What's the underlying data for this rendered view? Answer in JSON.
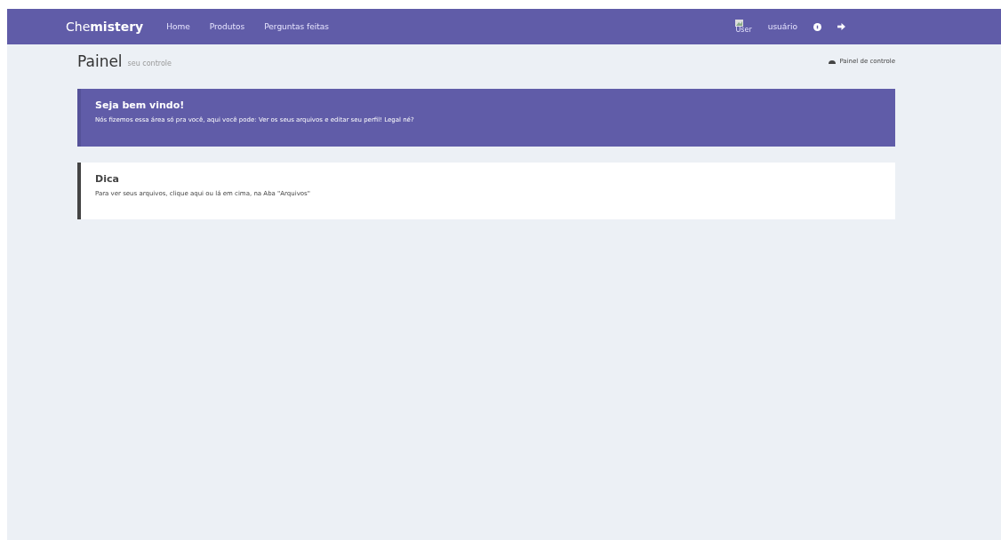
{
  "navbar": {
    "brand_light": "Che",
    "brand_bold": "mistery",
    "links": [
      {
        "label": "Home"
      },
      {
        "label": "Produtos"
      },
      {
        "label": "Perguntas feitas"
      }
    ],
    "user_image_alt": "User",
    "username": "usuário"
  },
  "header": {
    "title": "Painel",
    "subtitle": "seu controle",
    "breadcrumb": "Painel de controle"
  },
  "welcome": {
    "title": "Seja bem vindo!",
    "text": "Nós fizemos essa área só pra você, aqui você pode: Ver os seus arquivos e editar seu perfil! Legal né?"
  },
  "tip": {
    "title": "Dica",
    "text": "Para ver seus arquivos, clique aqui ou lá em cima, na Aba \"Arquivos\""
  }
}
